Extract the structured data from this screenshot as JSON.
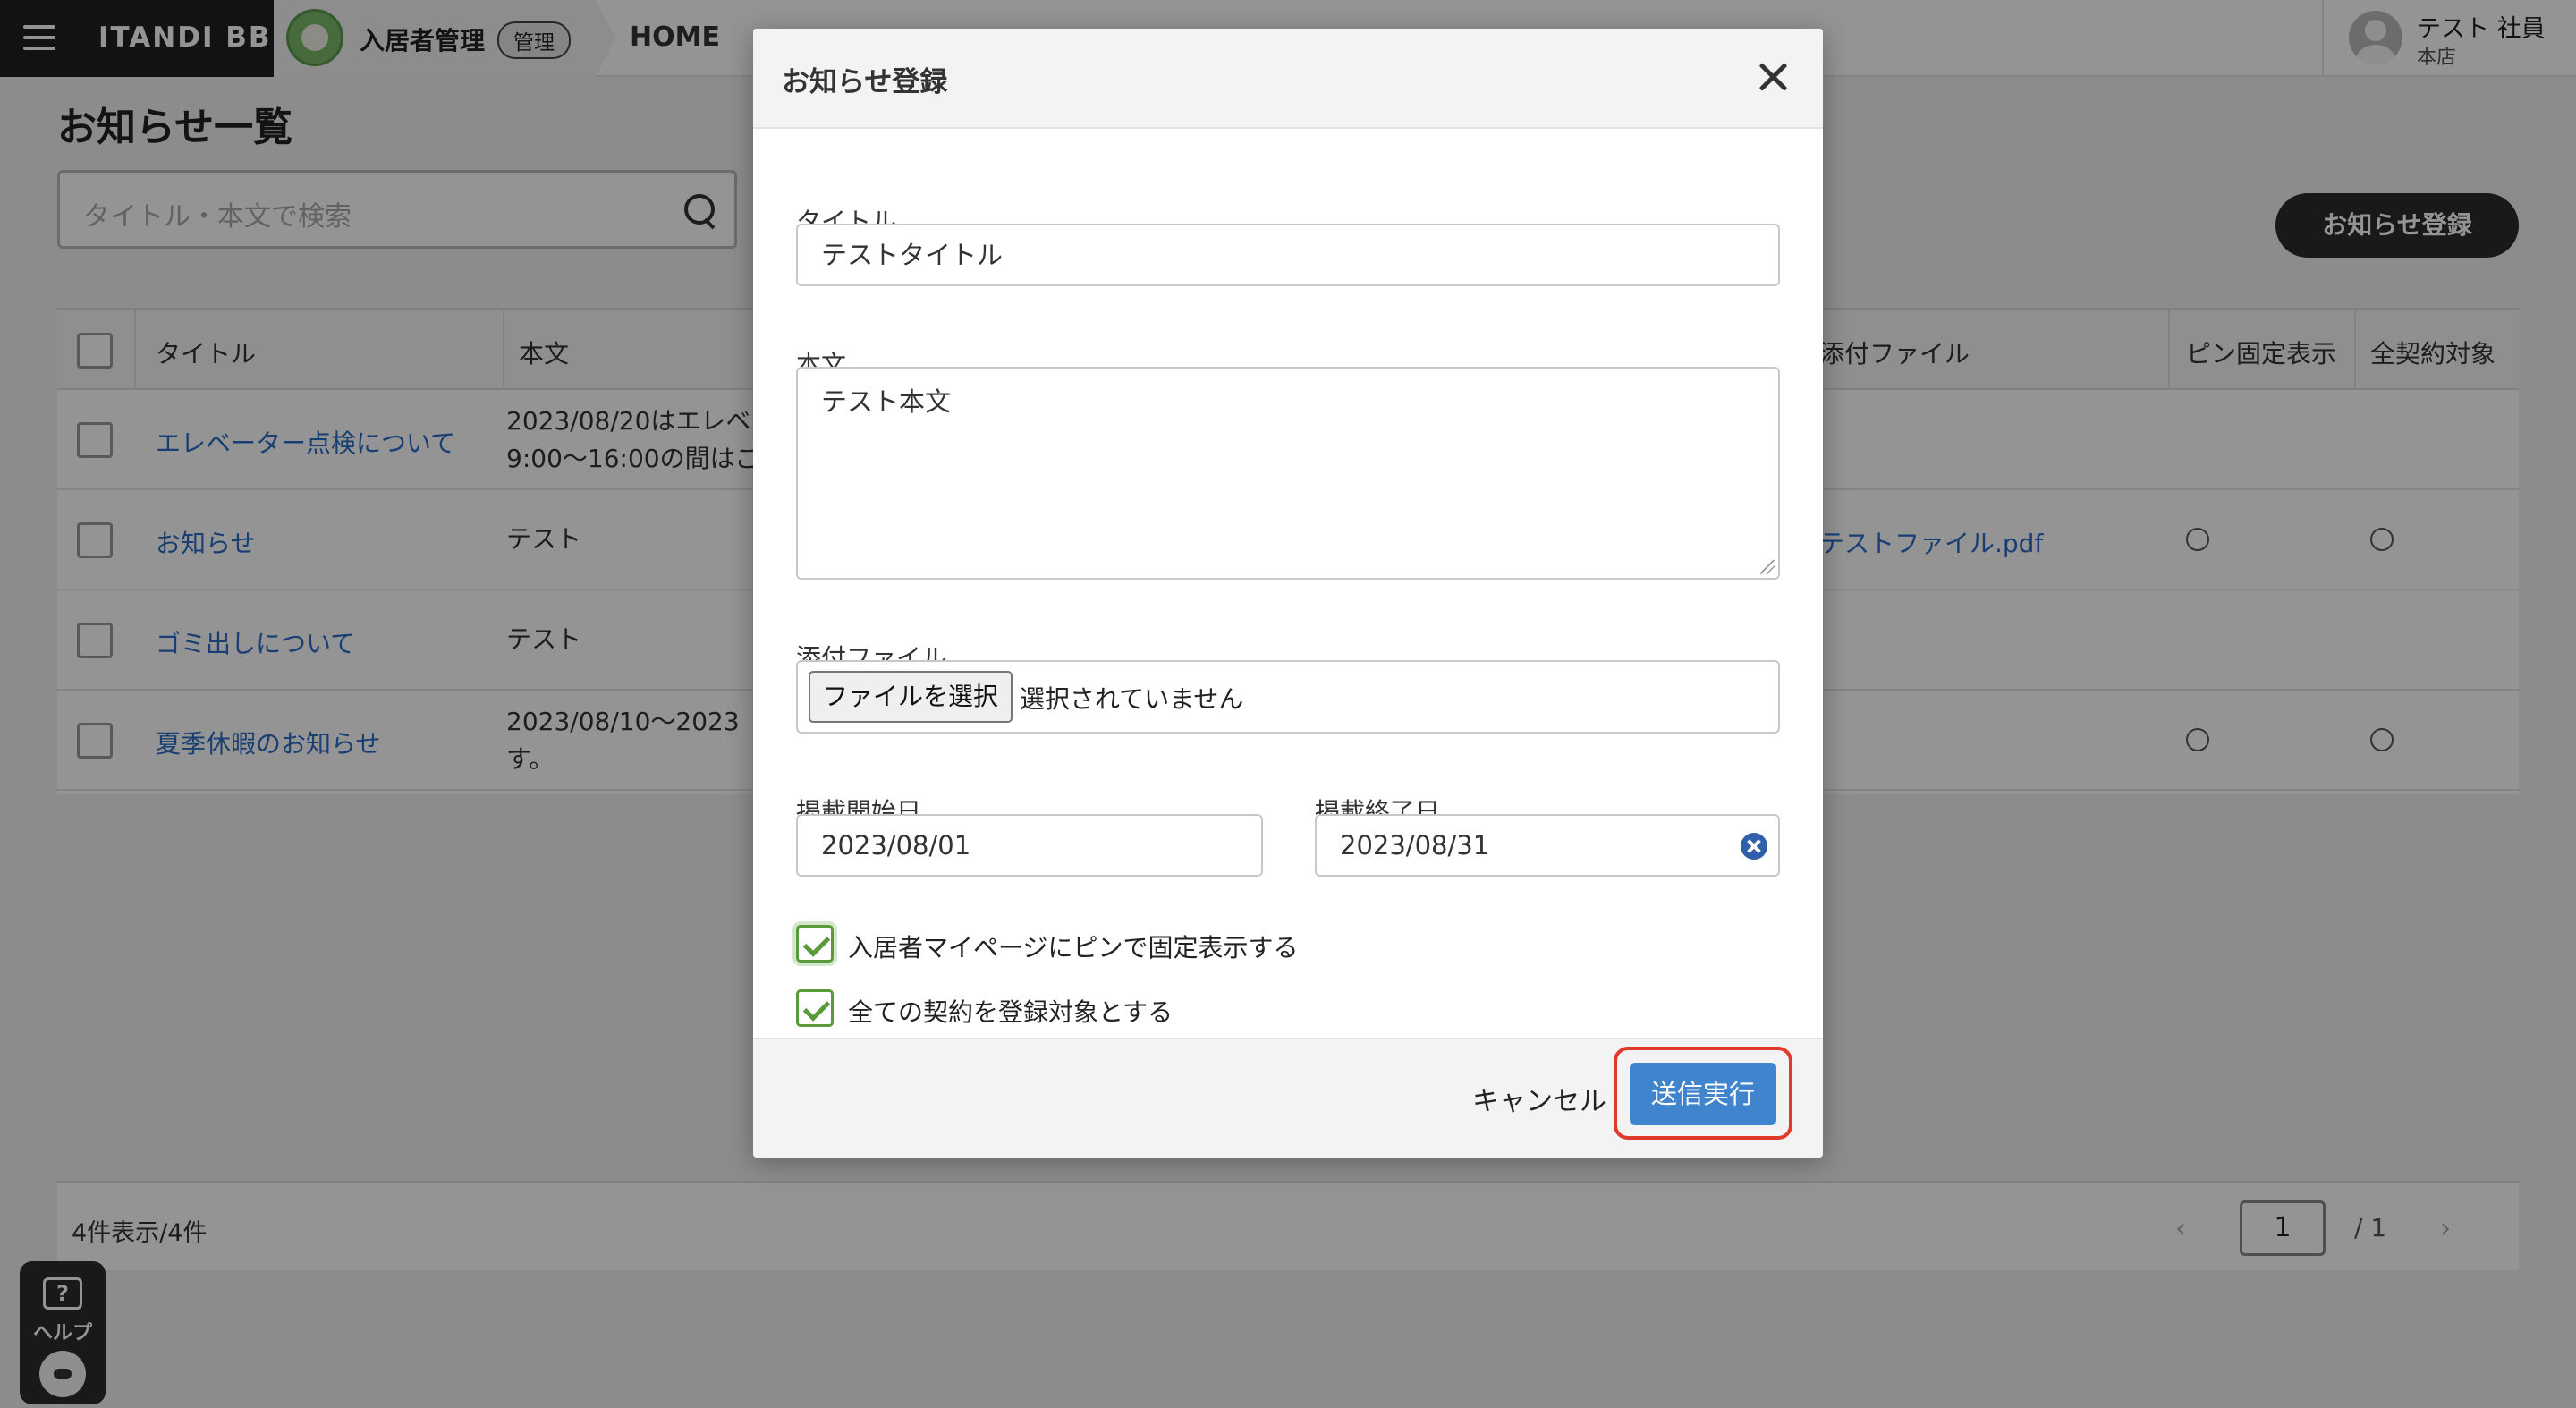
{
  "topbar": {
    "brand": "ITANDI BB",
    "app_name": "入居者管理",
    "app_badge": "管理",
    "home": "HOME"
  },
  "user": {
    "name": "テスト 社員",
    "branch": "本店"
  },
  "page": {
    "title": "お知らせ一覧",
    "search_placeholder": "タイトル・本文で検索",
    "register_button": "お知らせ登録"
  },
  "table": {
    "headers": {
      "title": "タイトル",
      "body": "本文",
      "file": "添付ファイル",
      "pin": "ピン固定表示",
      "all": "全契約対象"
    },
    "rows": [
      {
        "title": "エレベーター点検について",
        "body_line1": "2023/08/20はエレベ",
        "body_line2": "9:00～16:00の間はご",
        "file": "",
        "pin": "",
        "all": ""
      },
      {
        "title": "お知らせ",
        "body_line1": "テスト",
        "body_line2": "",
        "file": "テストファイル.pdf",
        "pin": "○",
        "all": "○"
      },
      {
        "title": "ゴミ出しについて",
        "body_line1": "テスト",
        "body_line2": "",
        "file": "",
        "pin": "",
        "all": ""
      },
      {
        "title": "夏季休暇のお知らせ",
        "body_line1": "2023/08/10～2023",
        "body_line2": "す。",
        "file": "",
        "pin": "○",
        "all": "○"
      }
    ]
  },
  "footer": {
    "count": "4件表示/4件",
    "prev": "‹",
    "page": "1",
    "total": "/ 1",
    "next": "›"
  },
  "help": {
    "icon": "?",
    "label": "ヘルプ"
  },
  "modal": {
    "title": "お知らせ登録",
    "title_label": "タイトル",
    "title_value": "テストタイトル",
    "body_label": "本文",
    "body_value": "テスト本文",
    "file_label": "添付ファイル",
    "file_button": "ファイルを選択",
    "file_status": "選択されていません",
    "start_label": "掲載開始日",
    "start_value": "2023/08/01",
    "end_label": "掲載終了日",
    "end_value": "2023/08/31",
    "pin_check": "入居者マイページにピンで固定表示する",
    "all_check": "全ての契約を登録対象とする",
    "cancel": "キャンセル",
    "submit": "送信実行"
  }
}
